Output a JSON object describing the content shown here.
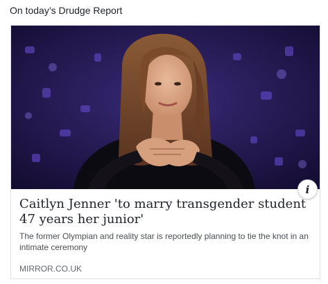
{
  "header": {
    "text": "On today’s Drudge Report"
  },
  "card": {
    "headline": "Caitlyn Jenner 'to marry transgender student 47 years her junior'",
    "description": "The former Olympian and reality star is reportedly planning to tie the knot in an intimate ceremony",
    "source": "MIRROR.CO.UK",
    "info_icon_glyph": "i",
    "info_icon": "info-icon",
    "image_subject": "photo"
  },
  "colors": {
    "text_primary": "#1d2129",
    "text_secondary": "#4b4f56",
    "source_gray": "#606770",
    "card_border": "#dddfe2",
    "image_bg": "#1b1440"
  }
}
